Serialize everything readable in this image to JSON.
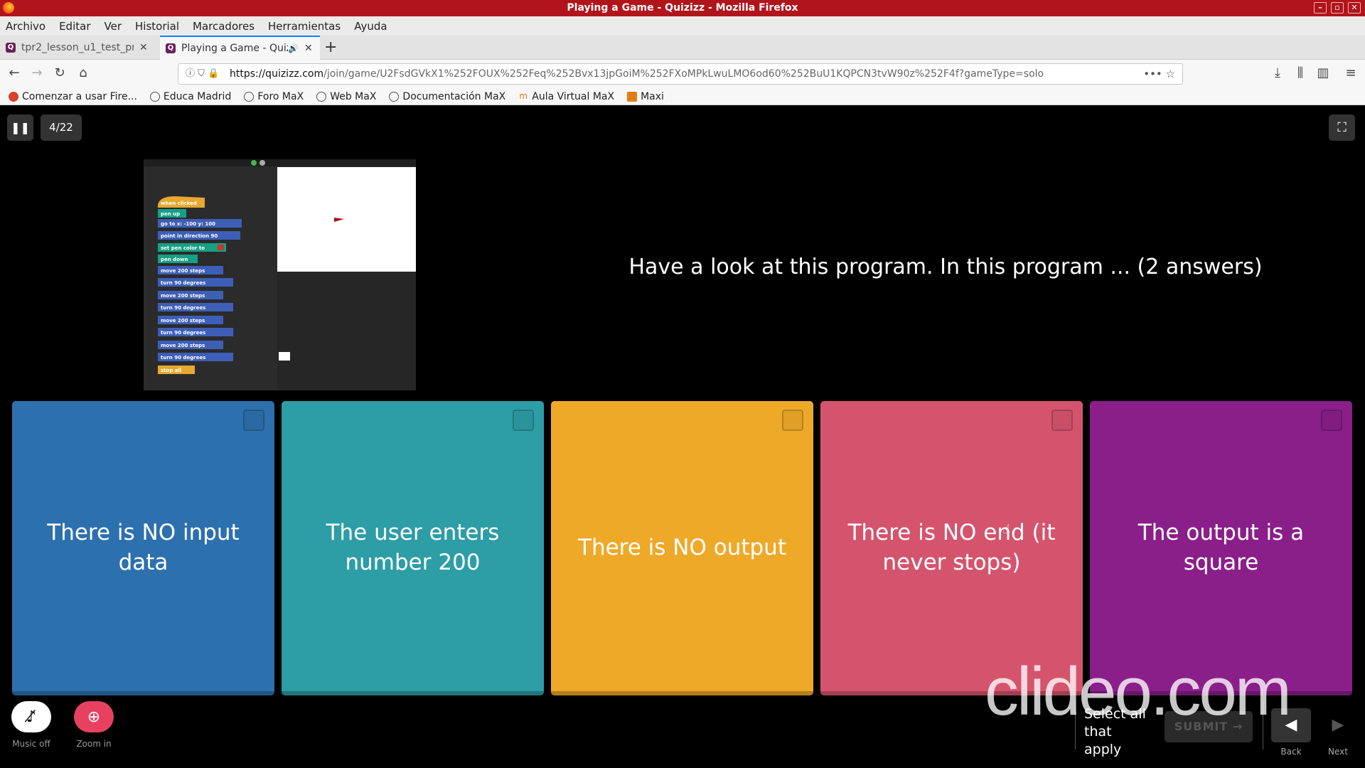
{
  "window": {
    "title": "Playing a Game - Quizizz - Mozilla Firefox"
  },
  "menu": [
    "Archivo",
    "Editar",
    "Ver",
    "Historial",
    "Marcadores",
    "Herramientas",
    "Ayuda"
  ],
  "tabs": [
    {
      "label": "tpr2_lesson_u1_test_pr",
      "active": false
    },
    {
      "label": "Playing a Game - Quiz",
      "active": true
    }
  ],
  "url": {
    "domain": "https://quizizz.com",
    "path": "/join/game/U2FsdGVkX1%252FOUX%252Feq%252Bvx13jpGoiM%252FXoMPkLwuLMO6od60%252BuU1KQPCN3tvW90z%252F4f?gameType=solo"
  },
  "bookmarks": [
    "Comenzar a usar Fire...",
    "Educa Madrid",
    "Foro MaX",
    "Web MaX",
    "Documentación MaX",
    "Aula Virtual MaX",
    "Maxi"
  ],
  "game": {
    "counter": "4/22",
    "question": "Have a look at this program. In this program ... (2 answers)",
    "options": [
      {
        "text": "There is NO input data",
        "color": "#2d70ae"
      },
      {
        "text": "The user enters number 200",
        "color": "#2d9da6"
      },
      {
        "text": "There is NO output",
        "color": "#efa929"
      },
      {
        "text": "There is NO end (it never stops)",
        "color": "#d5546d"
      },
      {
        "text": "The output is a square",
        "color": "#8a1f8a"
      }
    ],
    "controls": {
      "music_label": "Music off",
      "zoom_label": "Zoom in",
      "select_all": "Select all that apply",
      "submit": "SUBMIT",
      "back": "Back",
      "next": "Next"
    }
  },
  "watermark": "clideo.com",
  "program_blocks": [
    "when clicked",
    "pen up",
    "go to x: -100 y: 100",
    "point in direction 90",
    "set pen color to",
    "pen down",
    "move 200 steps",
    "turn 90 degrees",
    "move 200 steps",
    "turn 90 degrees",
    "move 200 steps",
    "turn 90 degrees",
    "move 200 steps",
    "turn 90 degrees",
    "stop all"
  ]
}
